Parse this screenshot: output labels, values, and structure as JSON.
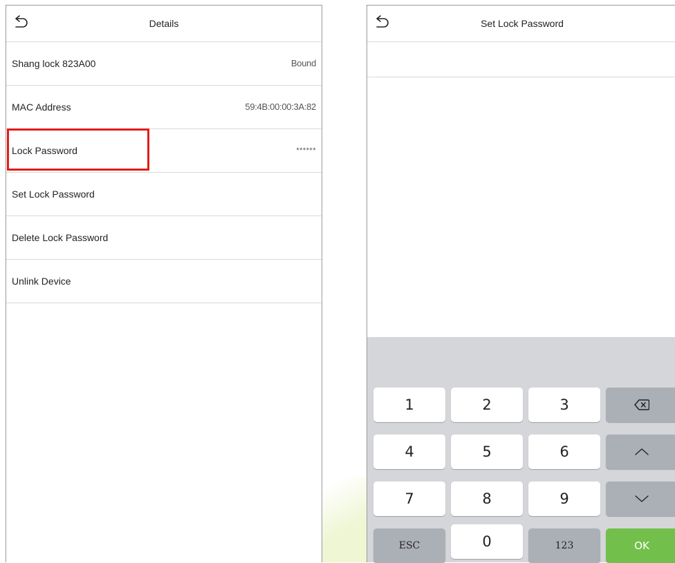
{
  "details": {
    "title": "Details",
    "rows": [
      {
        "label": "Shang lock 823A00",
        "value": "Bound"
      },
      {
        "label": "MAC Address",
        "value": "59:4B:00:00:3A:82"
      },
      {
        "label": "Lock Password",
        "value": "******"
      },
      {
        "label": "Set Lock Password",
        "value": ""
      },
      {
        "label": "Delete Lock Password",
        "value": ""
      },
      {
        "label": "Unlink Device",
        "value": ""
      }
    ]
  },
  "set_password": {
    "title": "Set Lock Password",
    "input_value": ""
  },
  "keypad": {
    "keys": {
      "k1": "1",
      "k2": "2",
      "k3": "3",
      "k4": "4",
      "k5": "5",
      "k6": "6",
      "k7": "7",
      "k8": "8",
      "k9": "9",
      "esc": "ESC",
      "k0": "0",
      "mode": "123",
      "ok": "OK"
    },
    "icons": {
      "backspace": "backspace-icon",
      "up": "chevron-up-icon",
      "down": "chevron-down-icon"
    }
  },
  "colors": {
    "highlight": "#e21b1b",
    "ok_key": "#72c04b",
    "keyboard_bg": "#d5d6da",
    "gray_key": "#abafb6"
  }
}
